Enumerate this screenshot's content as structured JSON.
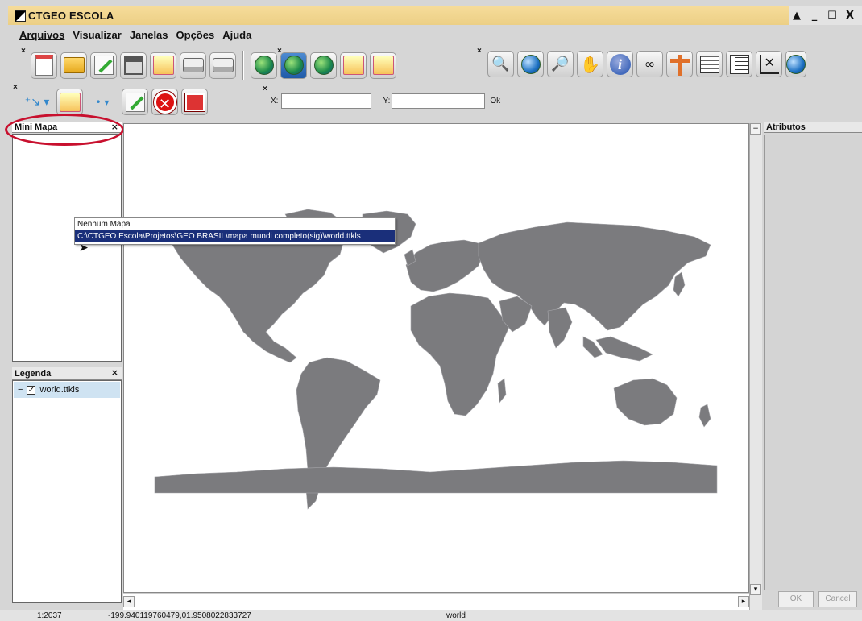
{
  "window": {
    "title": "CTGEO ESCOLA",
    "controls": [
      "▲",
      "_",
      "☐",
      "X"
    ]
  },
  "menu": [
    "Arquivos",
    "Visualizar",
    "Janelas",
    "Opções",
    "Ajuda"
  ],
  "toolbar": {
    "coord_x_label": "X:",
    "coord_y_label": "Y:",
    "coord_x_value": "",
    "coord_y_value": "",
    "ok_label": "Ok"
  },
  "panels": {
    "mini_mapa": {
      "title": "Mini Mapa",
      "close": "×"
    },
    "legenda": {
      "title": "Legenda",
      "close": "×",
      "item_expander": "−",
      "item_label": "world.ttkls",
      "item_checked": true
    },
    "atributos": {
      "title": "Atributos",
      "ok_label": "OK",
      "cancel_label": "Cancel"
    }
  },
  "dropdown": {
    "options": [
      "Nenhum Mapa",
      "C:\\CTGEO Escola\\Projetos\\GEO BRASIL\\mapa mundi completo(sig)\\world.ttkls"
    ],
    "selected_index": 1
  },
  "status": {
    "scale": "1:2037",
    "coordinates": "-199.940119760479,01.9508022833727",
    "layer": "world"
  },
  "colors": {
    "titlebar": "#f0d68e",
    "land": "#7b7b7e",
    "selection": "#1a2f7a",
    "highlight_ring": "#c8102e"
  }
}
